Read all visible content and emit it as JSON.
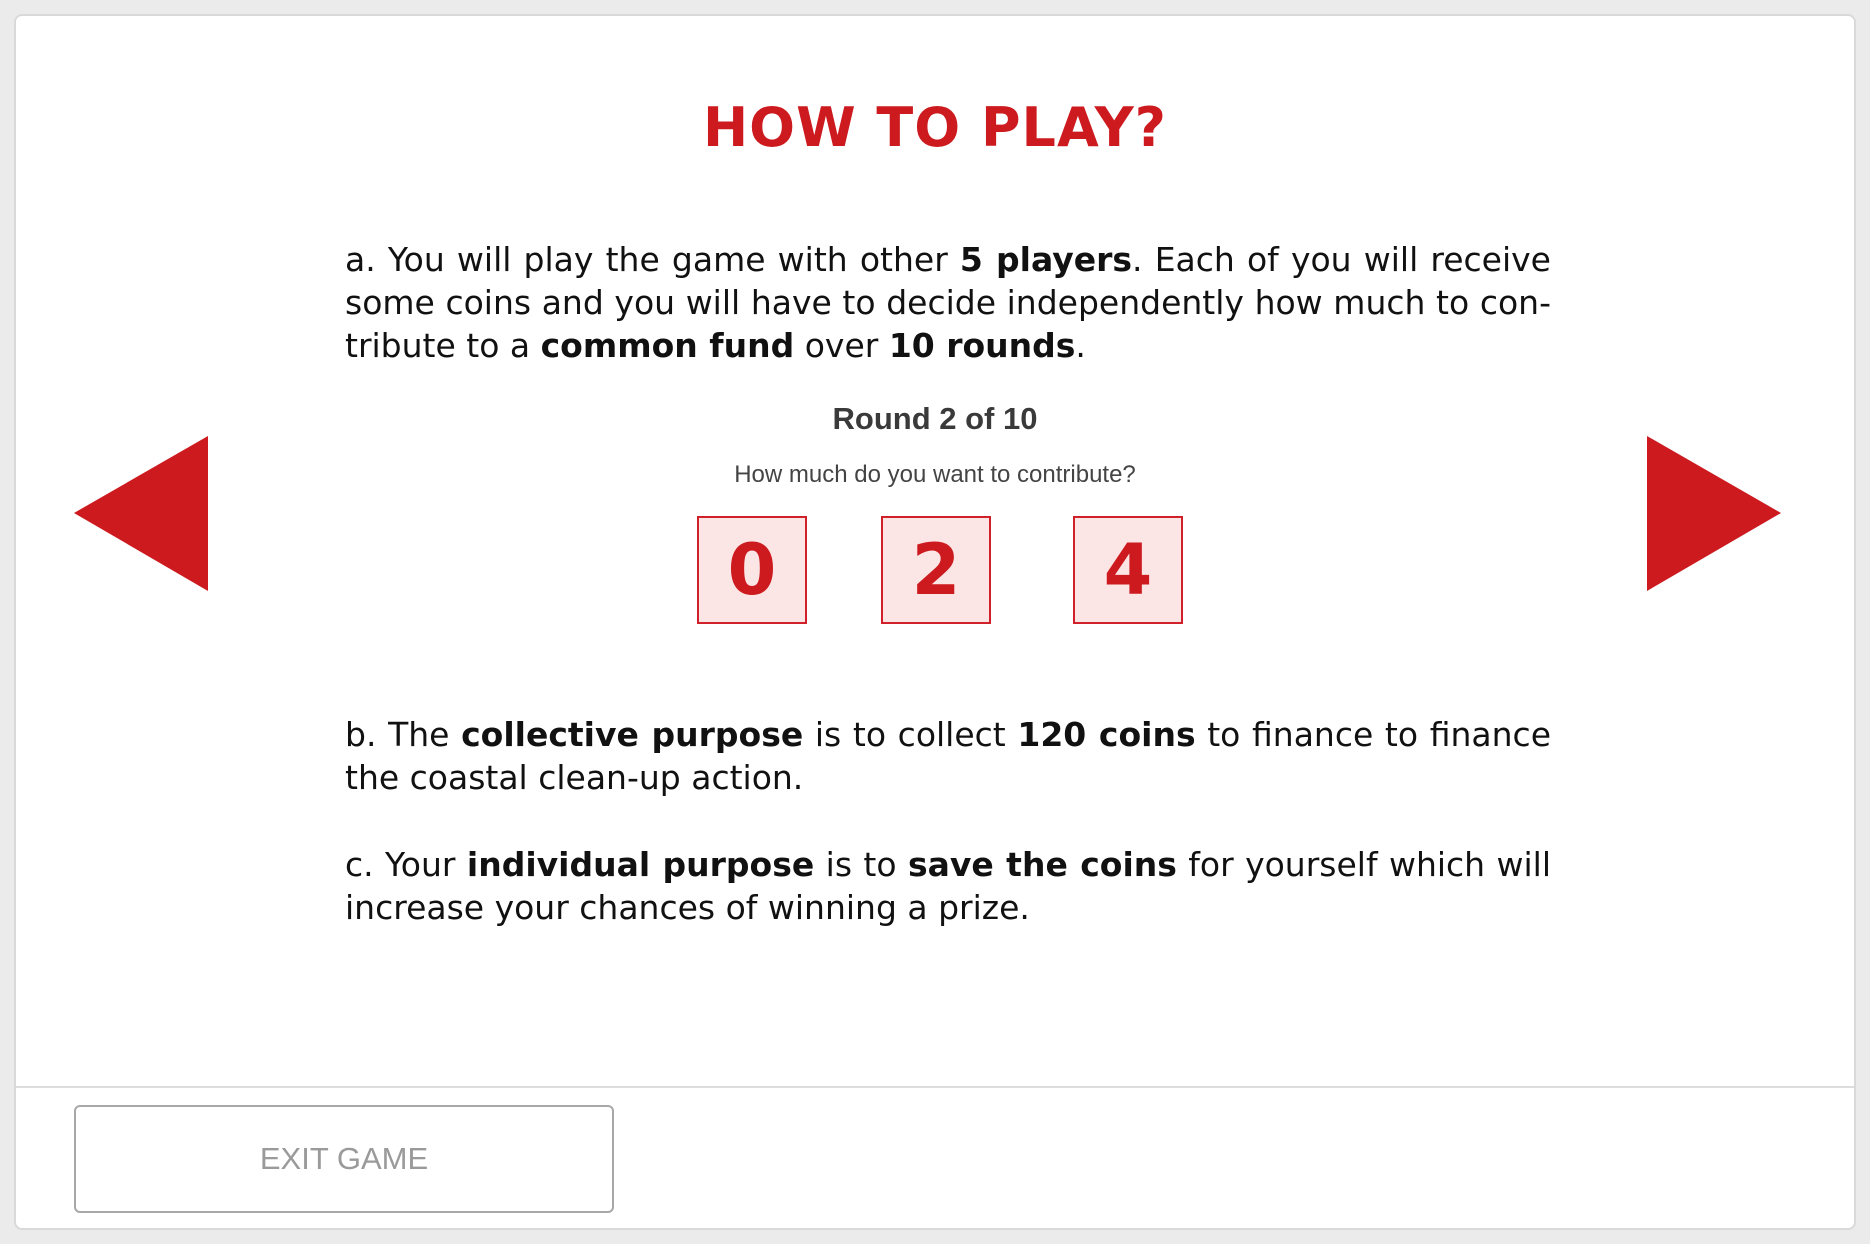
{
  "title": "HOW TO PLAY?",
  "accent_color": "#cc1a1f",
  "para_a": {
    "t1": "a. You will play the game with other ",
    "b1": "5 players",
    "t2": ". Each of you will receive some coins and you will have to decide independently how much to con­tribute to a ",
    "b2": "common fund",
    "t3": " over ",
    "b3": "10 rounds",
    "t4": "."
  },
  "round": {
    "title": "Round 2 of 10",
    "question": "How much do you want to contribute?",
    "digits": [
      "0",
      "2",
      "4"
    ]
  },
  "para_b": {
    "t1": "b. The ",
    "b1": "collective purpose",
    "t2": " is to collect ",
    "b2": "120 coins",
    "t3": " to finance to finance the coastal clean-up action."
  },
  "para_c": {
    "t1": "c. Your ",
    "b1": "individual purpose",
    "t2": " is to ",
    "b2": "save the coins",
    "t3": " for yourself which will increase your chances of winning a prize."
  },
  "nav": {
    "prev_icon": "triangle-left-icon",
    "next_icon": "triangle-right-icon"
  },
  "footer": {
    "exit_label": "EXIT GAME"
  }
}
